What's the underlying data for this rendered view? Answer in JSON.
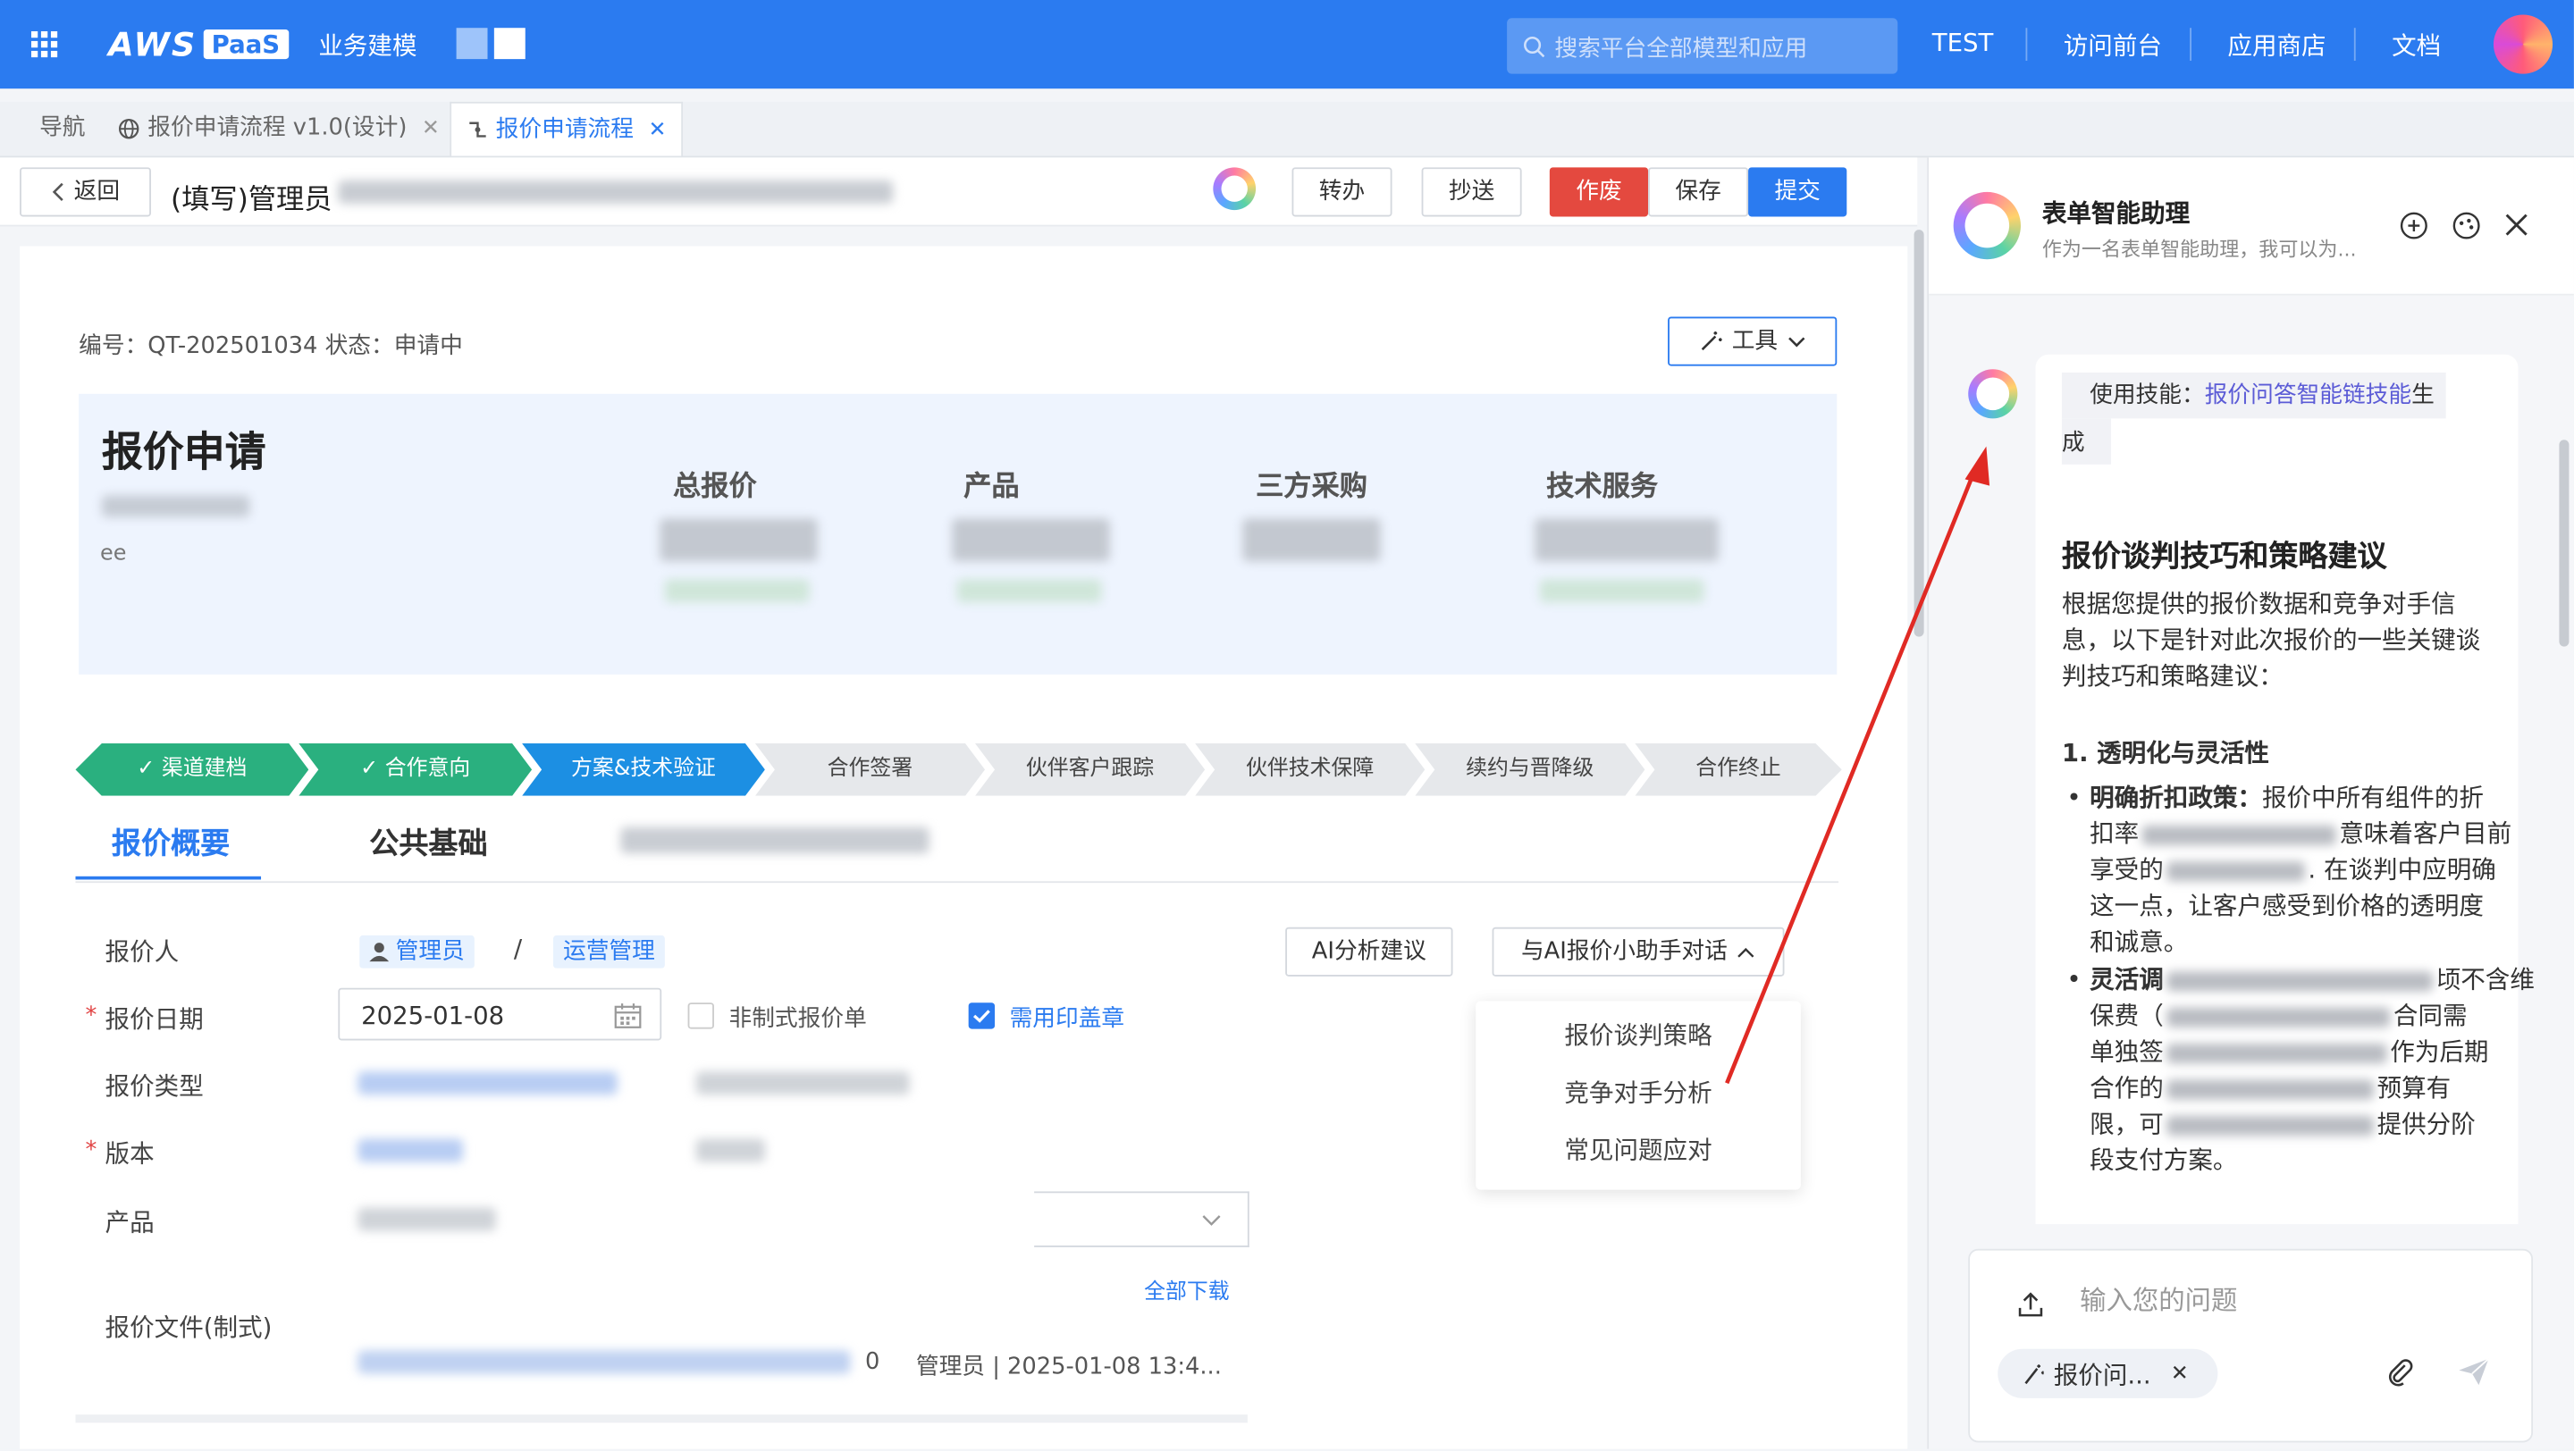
{
  "header": {
    "brand_aws": "AWS",
    "brand_paas": "PaaS",
    "app_name": "业务建模",
    "search_placeholder": "搜索平台全部模型和应用",
    "nav": [
      "TEST",
      "访问前台",
      "应用商店",
      "文档"
    ]
  },
  "tabs": [
    {
      "label": "导航"
    },
    {
      "label": "报价申请流程 v1.0(设计)"
    },
    {
      "label": "报价申请流程"
    }
  ],
  "toolbar": {
    "back": "返回",
    "title": "(填写)管理员",
    "transfer": "转办",
    "cc": "抄送",
    "void": "作废",
    "save": "保存",
    "submit": "提交"
  },
  "form": {
    "meta": "编号：QT-202501034 状态：申请中",
    "tools": "工具",
    "heading": "报价申请",
    "sub2": "ee",
    "summary_labels": [
      "总报价",
      "产品",
      "三方采购",
      "技术服务"
    ],
    "stages": [
      "渠道建档",
      "合作意向",
      "方案&技术验证",
      "合作签署",
      "伙伴客户跟踪",
      "伙伴技术保障",
      "续约与晋降级",
      "合作终止"
    ],
    "section_tabs": [
      "报价概要",
      "公共基础"
    ],
    "fields": {
      "quoter": "报价人",
      "quoter_user": "管理员",
      "slash": "/",
      "quoter_dept": "运营管理",
      "date_label": "报价日期",
      "date_value": "2025-01-08",
      "informal": "非制式报价单",
      "seal": "需用印盖章",
      "type": "报价类型",
      "version": "版本",
      "product": "产品",
      "file_label": "报价文件(制式)",
      "download_all": "全部下载",
      "file_num": "0",
      "file_meta": "管理员 | 2025-01-08 13:4..."
    },
    "ai_suggest": "AI分析建议",
    "ai_chat": "与AI报价小助手对话",
    "dropdown": [
      "报价谈判策略",
      "竞争对手分析",
      "常见问题应对"
    ]
  },
  "panel": {
    "title": "表单智能助理",
    "subtitle": "作为一名表单智能助理，我可以为...",
    "skill_prefix": "使用技能：",
    "skill_name": "报价问答智能链技能",
    "skill_suffix": "生",
    "skill_suffix2": "成",
    "answer_title": "报价谈判技巧和策略建议",
    "intro": [
      "根据您提供的报价数据和竞争对手信",
      "息，以下是针对此次报价的一些关键谈",
      "判技巧和策略建议："
    ],
    "point1_title": "1. 透明化与灵活性",
    "b1": {
      "bold": "明确折扣政策：",
      "l1": "报价中所有组件的折",
      "l2a": "扣率",
      "l2b": "意味着客户目前",
      "l3a": "享受的",
      "l3b": ". 在谈判中应明确",
      "l4": "这一点，让客户感受到价格的透明度",
      "l5": "和诚意。"
    },
    "b2": {
      "bold": "灵活调",
      "l1b": "顷不含维",
      "l2a": "保费（",
      "l2b": "合同需",
      "l3a": "单独签",
      "l3b": "作为后期",
      "l4a": "合作的",
      "l4b": "预算有",
      "l5a": "限，可",
      "l5b": "提供分阶",
      "l6": "段支付方案。"
    },
    "input_placeholder": "输入您的问题",
    "skill_chip": "报价问..."
  }
}
